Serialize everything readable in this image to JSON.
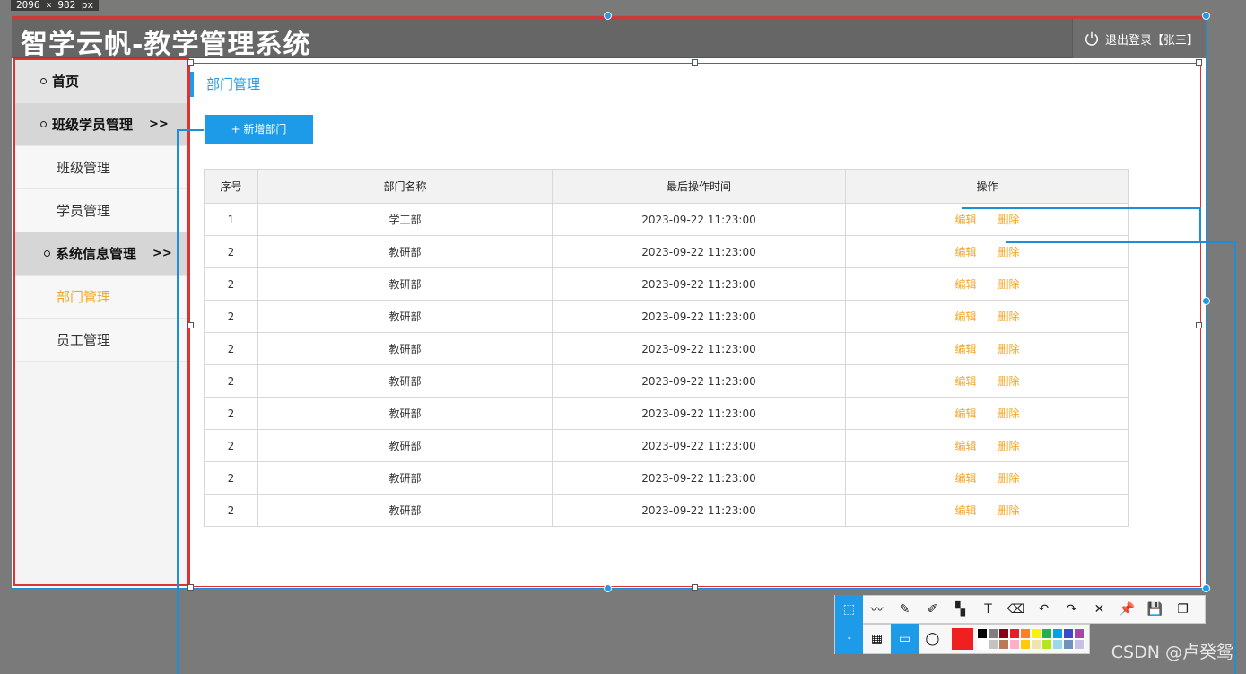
{
  "overlay": {
    "size_label": "2096 × 982 px"
  },
  "header": {
    "title": "智学云帆-教学管理系统",
    "logout_label": "退出登录【张三】"
  },
  "sidebar": {
    "items": [
      {
        "label": "首页",
        "kind": "top"
      },
      {
        "label": "班级学员管理",
        "arrow": ">>",
        "kind": "group"
      },
      {
        "label": "班级管理",
        "kind": "sub"
      },
      {
        "label": "学员管理",
        "kind": "sub"
      },
      {
        "label": "系统信息管理",
        "arrow": ">>",
        "kind": "group"
      },
      {
        "label": "部门管理",
        "kind": "sub",
        "active": true
      },
      {
        "label": "员工管理",
        "kind": "sub"
      }
    ]
  },
  "main": {
    "breadcrumb": "部门管理",
    "add_button": "+ 新增部门",
    "table": {
      "headers": [
        "序号",
        "部门名称",
        "最后操作时间",
        "操作"
      ],
      "rows": [
        [
          "1",
          "学工部",
          "2023-09-22 11:23:00"
        ],
        [
          "2",
          "教研部",
          "2023-09-22 11:23:00"
        ],
        [
          "2",
          "教研部",
          "2023-09-22 11:23:00"
        ],
        [
          "2",
          "教研部",
          "2023-09-22 11:23:00"
        ],
        [
          "2",
          "教研部",
          "2023-09-22 11:23:00"
        ],
        [
          "2",
          "教研部",
          "2023-09-22 11:23:00"
        ],
        [
          "2",
          "教研部",
          "2023-09-22 11:23:00"
        ],
        [
          "2",
          "教研部",
          "2023-09-22 11:23:00"
        ],
        [
          "2",
          "教研部",
          "2023-09-22 11:23:00"
        ],
        [
          "2",
          "教研部",
          "2023-09-22 11:23:00"
        ]
      ],
      "edit_label": "编辑",
      "delete_label": "删除"
    }
  },
  "toolbar": {
    "row1_icons": [
      "rect-select-icon",
      "polyline-icon",
      "pen-icon",
      "highlighter-icon",
      "mosaic-icon",
      "text-icon",
      "eraser-icon",
      "undo-icon",
      "redo-icon",
      "close-icon",
      "pin-icon",
      "save-icon",
      "copy-icon"
    ],
    "row1_glyphs": [
      "⬚",
      "〰",
      "✎",
      "✐",
      "▚",
      "T",
      "⌫",
      "↶",
      "↷",
      "✕",
      "📌",
      "💾",
      "❐"
    ],
    "palette": [
      "#000000",
      "#7f7f7f",
      "#880015",
      "#ed1c24",
      "#ff7f27",
      "#fff200",
      "#22b14c",
      "#00a2e8",
      "#3f48cc",
      "#a349a4",
      "#ffffff",
      "#c3c3c3",
      "#b97a57",
      "#ffaec9",
      "#ffc90e",
      "#efe4b0",
      "#b5e61d",
      "#99d9ea",
      "#7092be",
      "#c8bfe7"
    ],
    "current_color": "#f02020"
  },
  "watermark": "CSDN @卢癸鸳",
  "colors": {
    "accent": "#1e9be8",
    "action": "#f5a623",
    "header": "#666666"
  }
}
